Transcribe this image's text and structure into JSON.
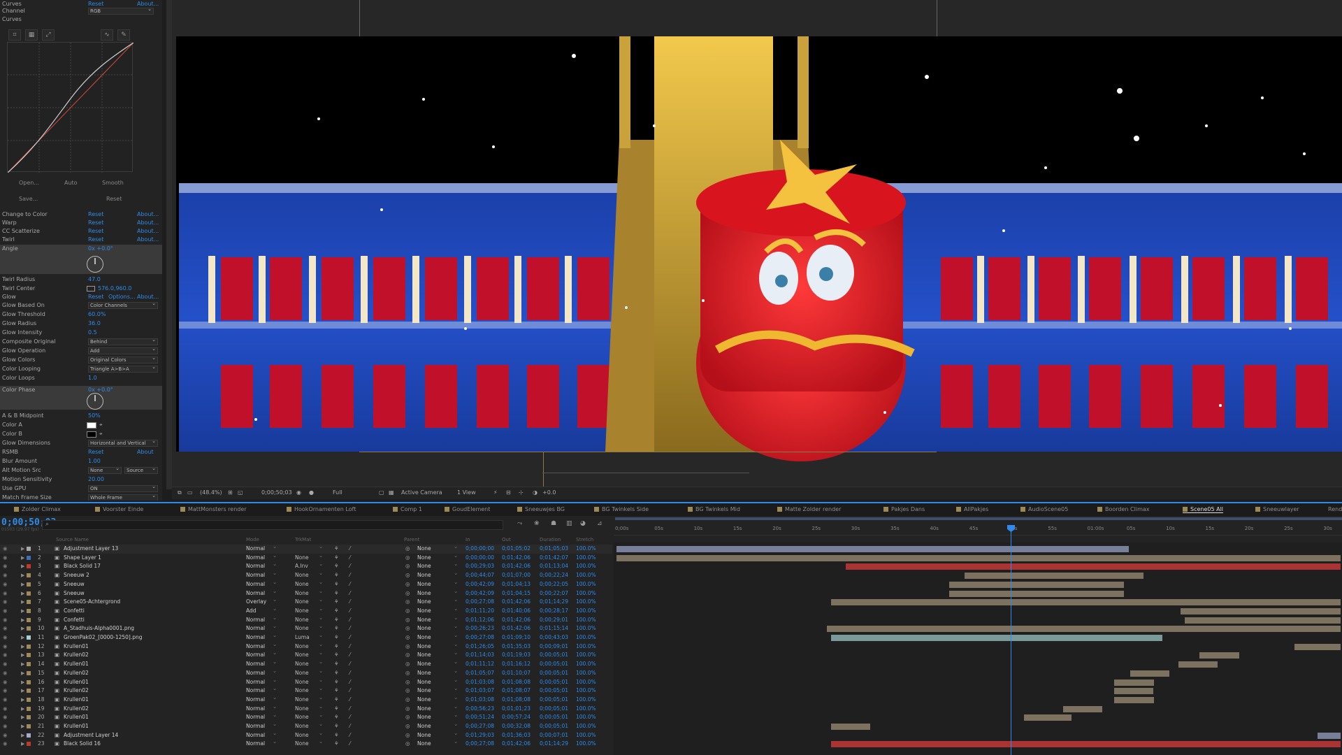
{
  "effect_controls": {
    "curves": {
      "title": "Curves",
      "reset": "Reset",
      "about": "About...",
      "channel_label": "Channel",
      "channel_value": "RGB",
      "curves_label": "Curves",
      "buttons": [
        "Open...",
        "Auto",
        "Smooth",
        "Save...",
        "Reset"
      ]
    },
    "rows": [
      {
        "name": "Change to Color",
        "v1": "Reset",
        "v2": "About..."
      },
      {
        "name": "Warp",
        "v1": "Reset",
        "v2": "About..."
      },
      {
        "name": "CC Scatterize",
        "v1": "Reset",
        "v2": "About..."
      },
      {
        "name": "Twirl",
        "v1": "Reset",
        "v2": "About..."
      }
    ],
    "twirl_angle": {
      "name": "Angle",
      "value": "0x +0.0°"
    },
    "twirl_radius": {
      "name": "Twirl Radius",
      "value": "47.0"
    },
    "twirl_center": {
      "name": "Twirl Center",
      "value": "576.0,960.0"
    },
    "glow_header": {
      "name": "Glow",
      "v1": "Reset",
      "opts": "Options...",
      "v2": "About..."
    },
    "glow_rows": [
      {
        "name": "Glow Based On",
        "value": "Color Channels",
        "type": "select"
      },
      {
        "name": "Glow Threshold",
        "value": "60.0%",
        "type": "value"
      },
      {
        "name": "Glow Radius",
        "value": "36.0",
        "type": "value"
      },
      {
        "name": "Glow Intensity",
        "value": "0.5",
        "type": "value"
      },
      {
        "name": "Composite Original",
        "value": "Behind",
        "type": "select"
      },
      {
        "name": "Glow Operation",
        "value": "Add",
        "type": "select"
      },
      {
        "name": "Glow Colors",
        "value": "Original Colors",
        "type": "select"
      },
      {
        "name": "Color Looping",
        "value": "Triangle A>B>A",
        "type": "select"
      },
      {
        "name": "Color Loops",
        "value": "1.0",
        "type": "value"
      },
      {
        "name": "Color Phase",
        "value": "0x +0.0°",
        "type": "value"
      }
    ],
    "glow_rows2": [
      {
        "name": "A & B Midpoint",
        "value": "50%",
        "type": "value"
      },
      {
        "name": "Color A",
        "value": "",
        "type": "swatch-white"
      },
      {
        "name": "Color B",
        "value": "",
        "type": "swatch-black"
      },
      {
        "name": "Glow Dimensions",
        "value": "Horizontal and Vertical",
        "type": "select"
      }
    ],
    "rsmb": {
      "name": "RSMB",
      "v1": "Reset",
      "v2": "About"
    },
    "rsmb_rows": [
      {
        "name": "Blur Amount",
        "value": "1.00",
        "type": "value"
      },
      {
        "name": "Alt Motion Src",
        "value": "None",
        "value2": "Source",
        "type": "select2"
      },
      {
        "name": "Motion Sensitivity",
        "value": "20.00",
        "type": "value"
      },
      {
        "name": "Use GPU",
        "value": "ON",
        "type": "select"
      },
      {
        "name": "Match Frame Size",
        "value": "Whole Frame",
        "type": "select"
      }
    ]
  },
  "viewer": {
    "zoom": "(48.4%)",
    "time": "0;00;50;03",
    "resolution": "Full",
    "camera": "Active Camera",
    "views": "1 View",
    "exposure": "+0.0"
  },
  "tabs": [
    {
      "label": "Zolder Climax",
      "color": "#9c8a55"
    },
    {
      "label": "Voorster Einde",
      "color": "#9c8a55"
    },
    {
      "label": "MattMonsters render",
      "color": "#9c8a55"
    },
    {
      "label": "HookOrnamenten Loft",
      "color": "#9c8a55"
    },
    {
      "label": "Comp 1",
      "color": "#9c8a55"
    },
    {
      "label": "GoudElement",
      "color": "#9c8a55"
    },
    {
      "label": "Sneeuwjes BG",
      "color": "#9c8a55"
    },
    {
      "label": "BG Twinkels Side",
      "color": "#9c8a55"
    },
    {
      "label": "BG Twinkels Mid",
      "color": "#9c8a55"
    },
    {
      "label": "Matte Zolder render",
      "color": "#9c8a55"
    },
    {
      "label": "Pakjes Dans",
      "color": "#9c8a55"
    },
    {
      "label": "AllPakjes",
      "color": "#9c8a55"
    },
    {
      "label": "AudioScene05",
      "color": "#9c8a55"
    },
    {
      "label": "Boorden Climax",
      "color": "#9c8a55"
    },
    {
      "label": "Scene05 All",
      "color": "#9c8a55",
      "active": true
    },
    {
      "label": "Sneeuwlayer",
      "color": "#9c8a55"
    },
    {
      "label": "Render Queue",
      "color": ""
    }
  ],
  "timeline": {
    "timecode": "0;00;50;03",
    "fps": "01503 (29.97 fps)",
    "headers": {
      "name": "Source Name",
      "mode": "Mode",
      "trkmat": "TrkMat",
      "parent": "Parent",
      "in": "In",
      "out": "Out",
      "duration": "Duration",
      "stretch": "Stretch"
    },
    "ruler": [
      "0;00s",
      "05s",
      "10s",
      "15s",
      "20s",
      "25s",
      "30s",
      "35s",
      "40s",
      "45s",
      "50s",
      "55s",
      "01:00s",
      "05s",
      "10s",
      "15s",
      "20s",
      "25s",
      "30s"
    ],
    "layers": [
      {
        "n": "1",
        "name": "Adjustment Layer 13",
        "color": "#a9a9a9",
        "mode": "Normal",
        "trk": "",
        "parent": "None",
        "in": "0;00;00;00",
        "out": "0;01;05;02",
        "dur": "0;01;05;03",
        "str": "100.0%"
      },
      {
        "n": "2",
        "name": "Shape Layer 1",
        "color": "#3b6fb6",
        "mode": "Normal",
        "trk": "None",
        "parent": "None",
        "in": "0;00;00;00",
        "out": "0;01;42;06",
        "dur": "0;01;42;07",
        "str": "100.0%"
      },
      {
        "n": "3",
        "name": "Black Solid 17",
        "color": "#c0392b",
        "mode": "Normal",
        "trk": "A.Inv",
        "parent": "None",
        "in": "0;00;29;03",
        "out": "0;01;42;06",
        "dur": "0;01;13;04",
        "str": "100.0%"
      },
      {
        "n": "4",
        "name": "Sneeuw 2",
        "color": "#a08a5a",
        "mode": "Normal",
        "trk": "None",
        "parent": "None",
        "in": "0;00;44;07",
        "out": "0;01;07;00",
        "dur": "0;00;22;24",
        "str": "100.0%"
      },
      {
        "n": "5",
        "name": "Sneeuw",
        "color": "#a08a5a",
        "mode": "Normal",
        "trk": "None",
        "parent": "None",
        "in": "0;00;42;09",
        "out": "0;01;04;13",
        "dur": "0;00;22;05",
        "str": "100.0%"
      },
      {
        "n": "6",
        "name": "Sneeuw",
        "color": "#a08a5a",
        "mode": "Normal",
        "trk": "None",
        "parent": "None",
        "in": "0;00;42;09",
        "out": "0;01;04;15",
        "dur": "0;00;22;07",
        "str": "100.0%"
      },
      {
        "n": "7",
        "name": "Scene05-Achtergrond",
        "color": "#a08a5a",
        "mode": "Overlay",
        "trk": "None",
        "parent": "None",
        "in": "0;00;27;08",
        "out": "0;01;42;06",
        "dur": "0;01;14;29",
        "str": "100.0%"
      },
      {
        "n": "8",
        "name": "Confetti",
        "color": "#a08a5a",
        "mode": "Add",
        "trk": "None",
        "parent": "None",
        "in": "0;01;11;20",
        "out": "0;01;40;06",
        "dur": "0;00;28;17",
        "str": "100.0%"
      },
      {
        "n": "9",
        "name": "Confetti",
        "color": "#a08a5a",
        "mode": "Normal",
        "trk": "None",
        "parent": "None",
        "in": "0;01;12;06",
        "out": "0;01;42;06",
        "dur": "0;00;29;01",
        "str": "100.0%"
      },
      {
        "n": "10",
        "name": "A_Stadhuis-Alpha0001.png",
        "color": "#a08a5a",
        "mode": "Normal",
        "trk": "None",
        "parent": "None",
        "in": "0;00;26;23",
        "out": "0;01;42;06",
        "dur": "0;01;15;14",
        "str": "100.0%"
      },
      {
        "n": "11",
        "name": "GroenPak02_[0000-1250].png",
        "color": "#a9d0d0",
        "mode": "Normal",
        "trk": "Luma",
        "parent": "None",
        "in": "0;00;27;08",
        "out": "0;01;09;10",
        "dur": "0;00;43;03",
        "str": "100.0%"
      },
      {
        "n": "12",
        "name": "Krullen01",
        "color": "#a08a5a",
        "mode": "Normal",
        "trk": "None",
        "parent": "None",
        "in": "0;01;26;05",
        "out": "0;01;35;03",
        "dur": "0;00;09;01",
        "str": "100.0%"
      },
      {
        "n": "13",
        "name": "Krullen02",
        "color": "#a08a5a",
        "mode": "Normal",
        "trk": "None",
        "parent": "None",
        "in": "0;01;14;03",
        "out": "0;01;19;03",
        "dur": "0;00;05;01",
        "str": "100.0%"
      },
      {
        "n": "14",
        "name": "Krullen01",
        "color": "#a08a5a",
        "mode": "Normal",
        "trk": "None",
        "parent": "None",
        "in": "0;01;11;12",
        "out": "0;01;16;12",
        "dur": "0;00;05;01",
        "str": "100.0%"
      },
      {
        "n": "15",
        "name": "Krullen02",
        "color": "#a08a5a",
        "mode": "Normal",
        "trk": "None",
        "parent": "None",
        "in": "0;01;05;07",
        "out": "0;01;10;07",
        "dur": "0;00;05;01",
        "str": "100.0%"
      },
      {
        "n": "16",
        "name": "Krullen01",
        "color": "#a08a5a",
        "mode": "Normal",
        "trk": "None",
        "parent": "None",
        "in": "0;01;03;08",
        "out": "0;01;08;08",
        "dur": "0;00;05;01",
        "str": "100.0%"
      },
      {
        "n": "17",
        "name": "Krullen02",
        "color": "#a08a5a",
        "mode": "Normal",
        "trk": "None",
        "parent": "None",
        "in": "0;01;03;07",
        "out": "0;01;08;07",
        "dur": "0;00;05;01",
        "str": "100.0%"
      },
      {
        "n": "18",
        "name": "Krullen01",
        "color": "#a08a5a",
        "mode": "Normal",
        "trk": "None",
        "parent": "None",
        "in": "0;01;03;08",
        "out": "0;01;08;08",
        "dur": "0;00;05;01",
        "str": "100.0%"
      },
      {
        "n": "19",
        "name": "Krullen02",
        "color": "#a08a5a",
        "mode": "Normal",
        "trk": "None",
        "parent": "None",
        "in": "0;00;56;23",
        "out": "0;01;01;23",
        "dur": "0;00;05;01",
        "str": "100.0%"
      },
      {
        "n": "20",
        "name": "Krullen01",
        "color": "#a08a5a",
        "mode": "Normal",
        "trk": "None",
        "parent": "None",
        "in": "0;00;51;24",
        "out": "0;00;57;24",
        "dur": "0;00;05;01",
        "str": "100.0%"
      },
      {
        "n": "21",
        "name": "Krullen01",
        "color": "#a08a5a",
        "mode": "Normal",
        "trk": "None",
        "parent": "None",
        "in": "0;00;27;08",
        "out": "0;00;32;08",
        "dur": "0;00;05;01",
        "str": "100.0%"
      },
      {
        "n": "22",
        "name": "Adjustment Layer 14",
        "color": "#a9a9c9",
        "mode": "Normal",
        "trk": "None",
        "parent": "None",
        "in": "0;01;29;03",
        "out": "0;01;36;03",
        "dur": "0;00;07;01",
        "str": "100.0%"
      },
      {
        "n": "23",
        "name": "Black Solid 16",
        "color": "#c0392b",
        "mode": "Normal",
        "trk": "None",
        "parent": "None",
        "in": "0;00;27;08",
        "out": "0;01;42;06",
        "dur": "0;01;14;29",
        "str": "100.0%"
      }
    ]
  }
}
